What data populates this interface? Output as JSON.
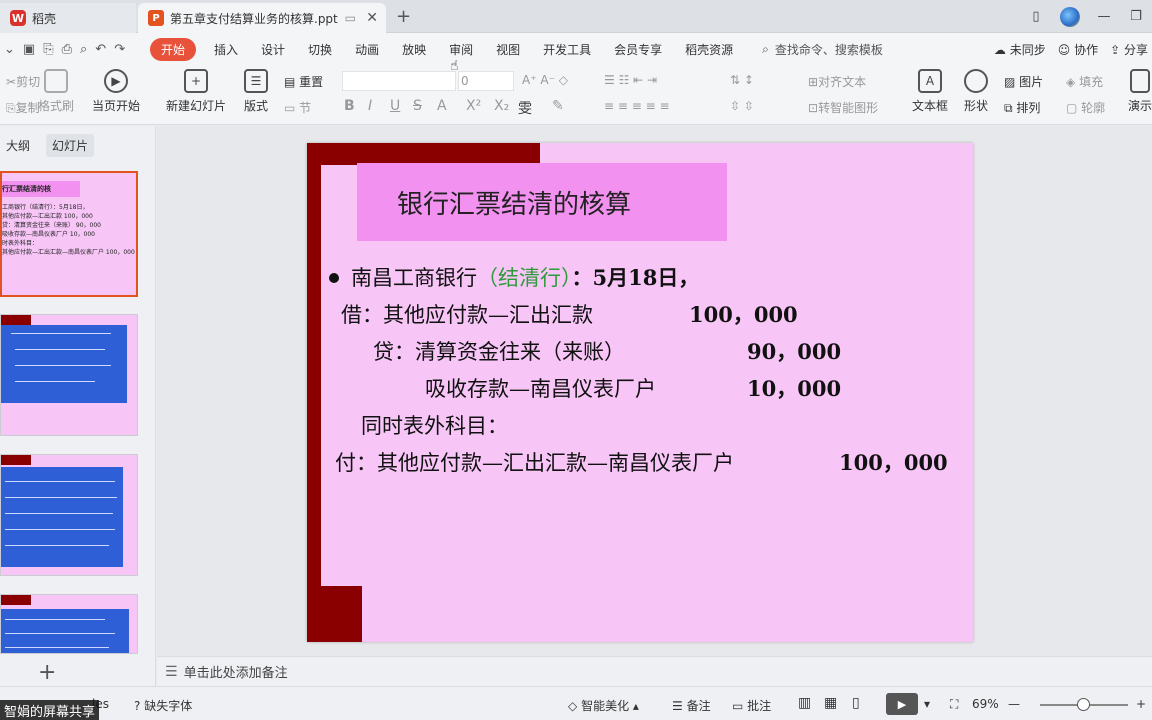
{
  "titlebar": {
    "home_tab": "稻壳",
    "doc_tab": "第五章支付结算业务的核算.ppt",
    "home_logo": "W",
    "doc_logo": "P",
    "new_tab": "+"
  },
  "menu": {
    "items": [
      "开始",
      "插入",
      "设计",
      "切换",
      "动画",
      "放映",
      "审阅",
      "视图",
      "开发工具",
      "会员专享",
      "稻壳资源"
    ],
    "search": "查找命令、搜索模板",
    "right": [
      "未同步",
      "协作",
      "分享"
    ]
  },
  "ribbon": {
    "cut": "剪切",
    "copy": "复制",
    "format_painter": "格式刷",
    "from_current": "当页开始",
    "new_slide": "新建幻灯片",
    "layout": "版式",
    "section": "节",
    "reset": "重置",
    "font_size": "0",
    "align_text": "对齐文本",
    "smartart": "转智能图形",
    "textbox": "文本框",
    "shape": "形状",
    "picture": "图片",
    "arrange": "排列",
    "fill": "填充",
    "outline": "轮廓",
    "present": "演示"
  },
  "left_panel": {
    "tab_outline": "大纲",
    "tab_slides": "幻灯片",
    "add": "+"
  },
  "slide": {
    "title": "银行汇票结清的核算",
    "l1_a": "南昌工商银行",
    "l1_b": "（结清行）",
    "l1_c": "：5月18日，",
    "l2_a": "借：其他应付款—汇出汇款",
    "l2_b": "100，000",
    "l3_a": "贷：清算资金往来（来账）",
    "l3_b": "90，000",
    "l4_a": "吸收存款—南昌仪表厂户",
    "l4_b": "10，000",
    "l5": "同时表外科目：",
    "l6_a": "付：其他应付款—汇出汇款—南昌仪表厂户",
    "l6_b": "100，000"
  },
  "thumbs": {
    "t1_title": "行汇票结清的核",
    "t1_lines": [
      "工商银行（结清行）：5月18日，",
      "其他应付款—汇出汇款  100，000",
      "贷：清算资金往来（来账）  90，000",
      "吸收存款—南昌仪表厂户  10，000",
      "时表外科目：",
      "其他应付款—汇出汇款—南昌仪表厂户 100，000"
    ]
  },
  "notes": {
    "placeholder": "单击此处添加备注"
  },
  "status": {
    "watermark": "智娟的屏幕共享",
    "slides_label": "les",
    "missing_font": "缺失字体",
    "beautify": "智能美化",
    "notes": "备注",
    "comments": "批注",
    "zoom": "69%"
  },
  "colors": {
    "accent": "#e8513a",
    "slide_bg": "#f7c6f7",
    "title_box": "#f291f0",
    "dark_red": "#8a0000",
    "green_text": "#2e9a3a"
  }
}
